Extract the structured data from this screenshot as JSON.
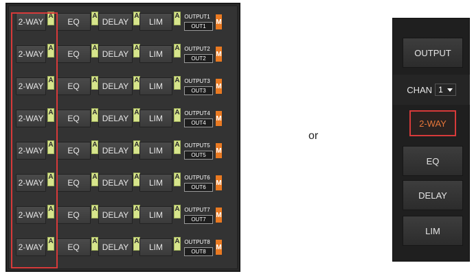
{
  "left_panel": {
    "rows": [
      {
        "twoway": "2-WAY",
        "eq": "EQ",
        "delay": "DELAY",
        "lim": "LIM",
        "output": "OUTPUT1",
        "out": "OUT1",
        "a": "A",
        "m": "M"
      },
      {
        "twoway": "2-WAY",
        "eq": "EQ",
        "delay": "DELAY",
        "lim": "LIM",
        "output": "OUTPUT2",
        "out": "OUT2",
        "a": "A",
        "m": "M"
      },
      {
        "twoway": "2-WAY",
        "eq": "EQ",
        "delay": "DELAY",
        "lim": "LIM",
        "output": "OUTPUT3",
        "out": "OUT3",
        "a": "A",
        "m": "M"
      },
      {
        "twoway": "2-WAY",
        "eq": "EQ",
        "delay": "DELAY",
        "lim": "LIM",
        "output": "OUTPUT4",
        "out": "OUT4",
        "a": "A",
        "m": "M"
      },
      {
        "twoway": "2-WAY",
        "eq": "EQ",
        "delay": "DELAY",
        "lim": "LIM",
        "output": "OUTPUT5",
        "out": "OUT5",
        "a": "A",
        "m": "M"
      },
      {
        "twoway": "2-WAY",
        "eq": "EQ",
        "delay": "DELAY",
        "lim": "LIM",
        "output": "OUTPUT6",
        "out": "OUT6",
        "a": "A",
        "m": "M"
      },
      {
        "twoway": "2-WAY",
        "eq": "EQ",
        "delay": "DELAY",
        "lim": "LIM",
        "output": "OUTPUT7",
        "out": "OUT7",
        "a": "A",
        "m": "M"
      },
      {
        "twoway": "2-WAY",
        "eq": "EQ",
        "delay": "DELAY",
        "lim": "LIM",
        "output": "OUTPUT8",
        "out": "OUT8",
        "a": "A",
        "m": "M"
      }
    ]
  },
  "separator_text": "or",
  "right_panel": {
    "output_label": "OUTPUT",
    "chan_label": "CHAN",
    "chan_value": "1",
    "twoway_label": "2-WAY",
    "eq_label": "EQ",
    "delay_label": "DELAY",
    "lim_label": "LIM"
  },
  "colors": {
    "a_badge": "#d7e58c",
    "m_badge": "#ea7a22",
    "highlight": "#d83a3a",
    "active_text": "#e7773a"
  }
}
